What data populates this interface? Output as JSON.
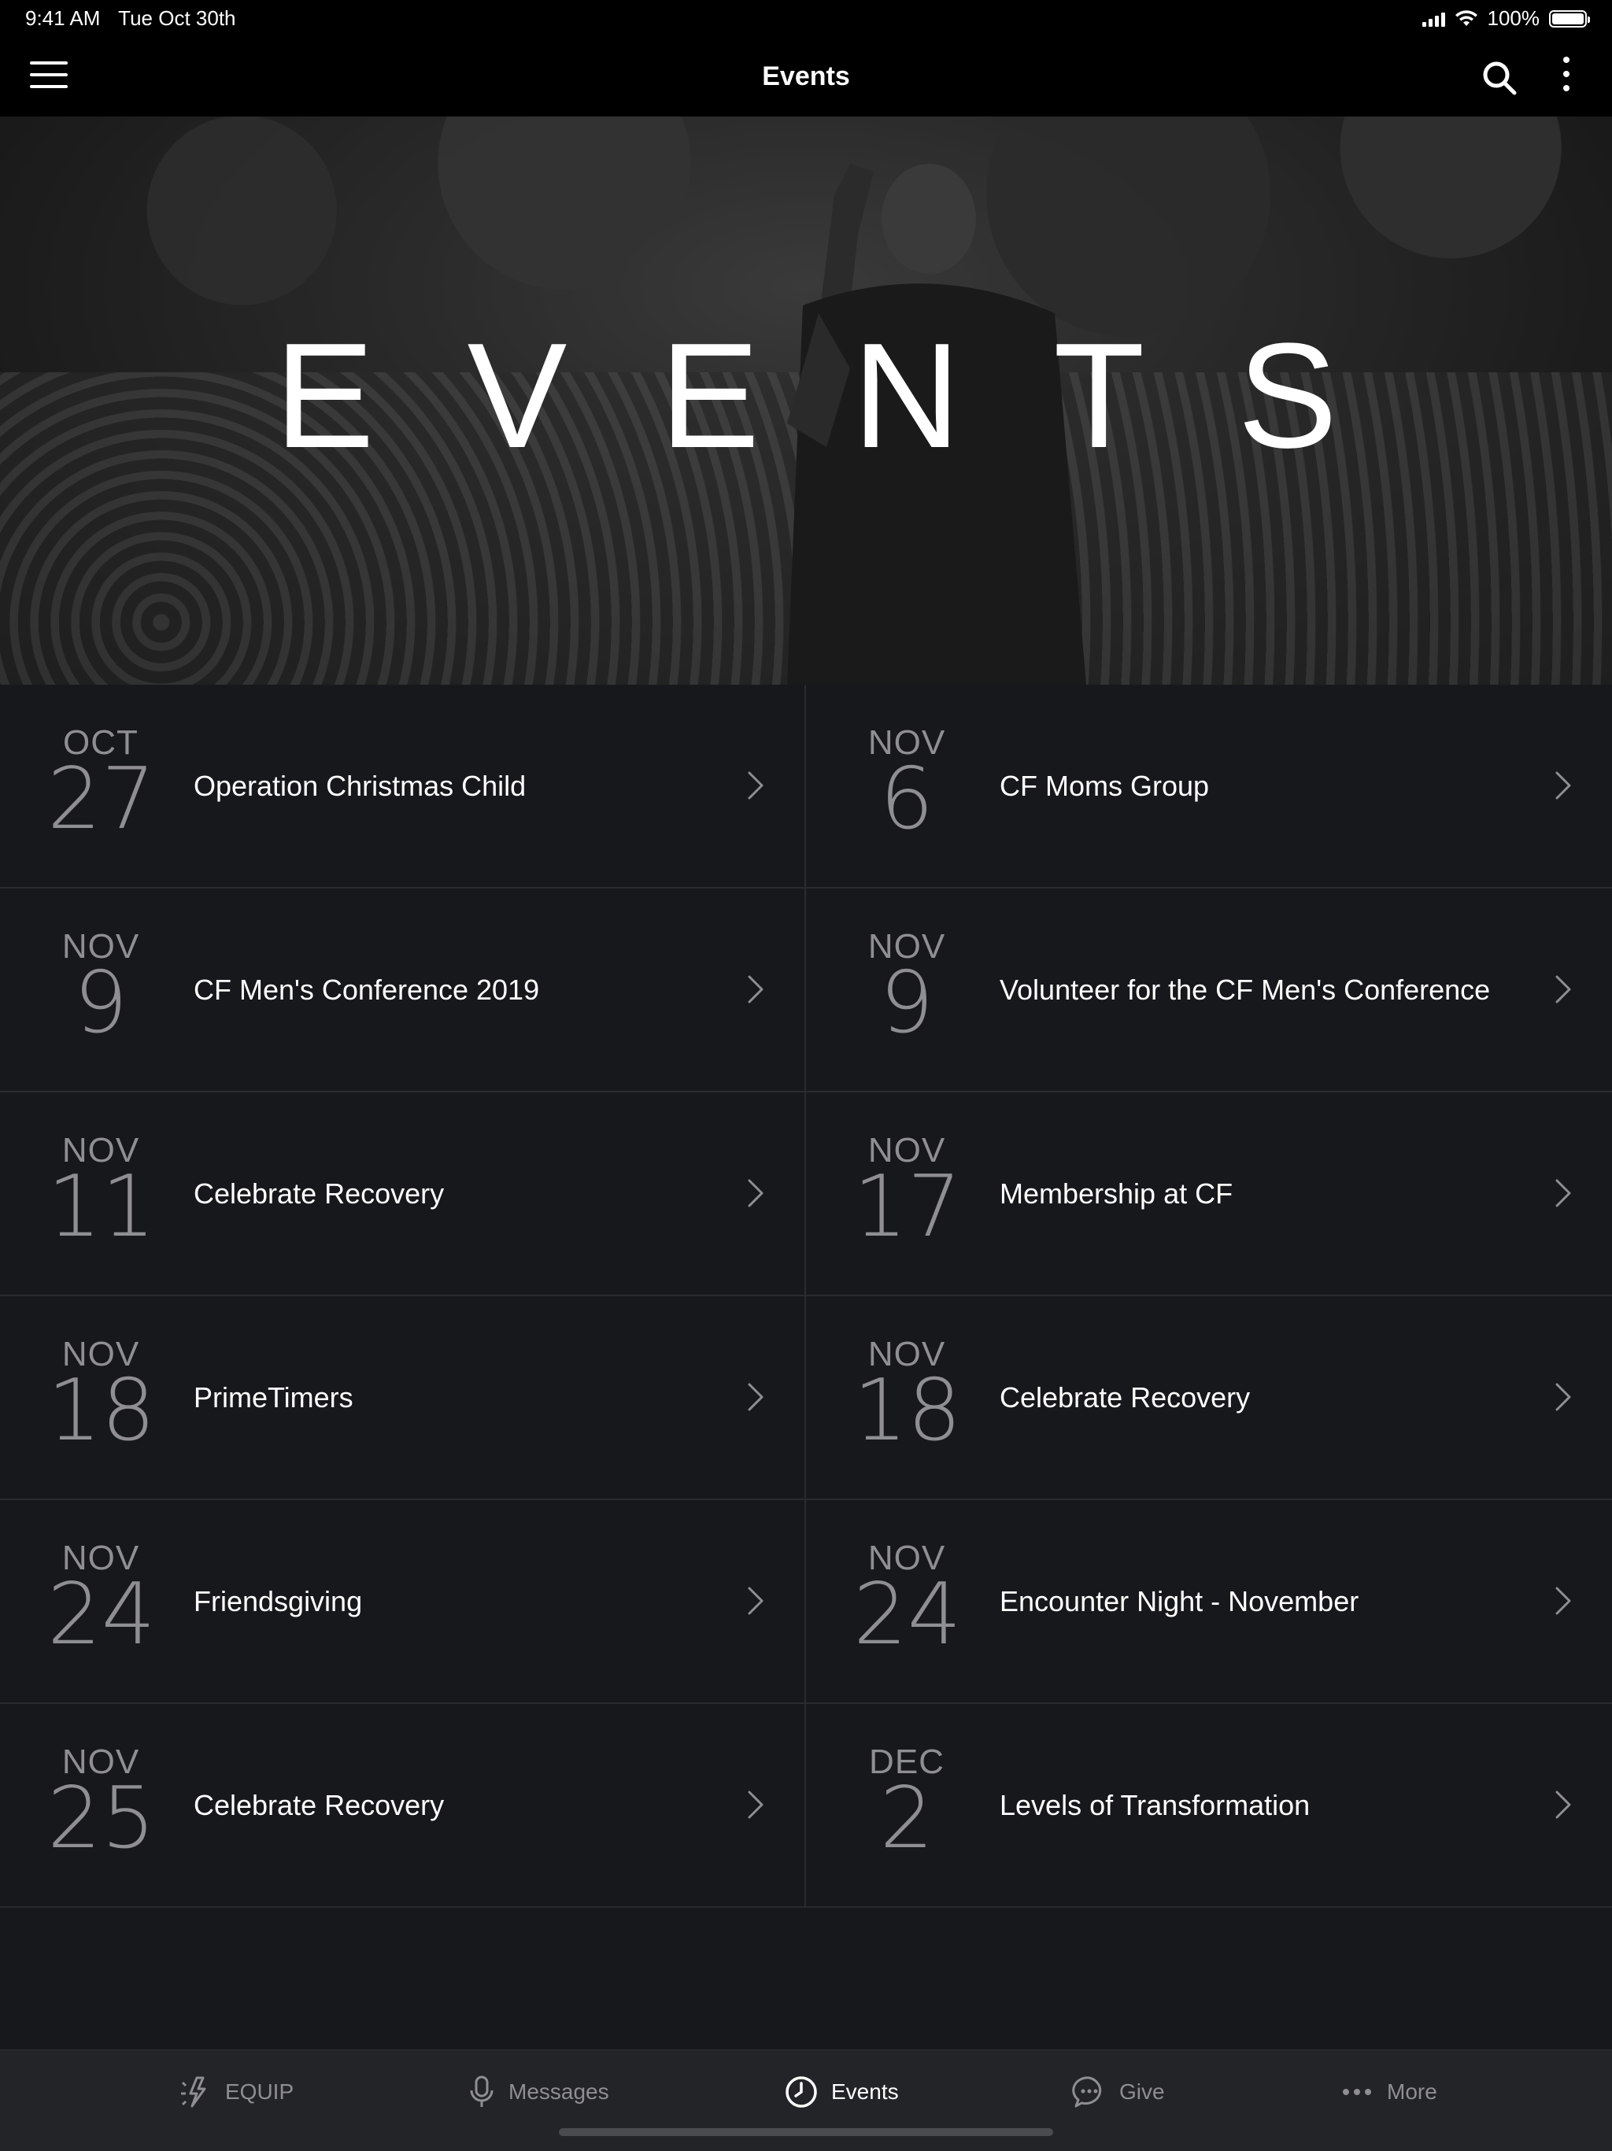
{
  "status_bar": {
    "time": "9:41 AM",
    "date": "Tue Oct 30th",
    "battery": "100%",
    "battery_level": 1.0
  },
  "nav": {
    "title": "Events"
  },
  "hero": {
    "title": "EVENTS"
  },
  "events": [
    {
      "month": "OCT",
      "day": "27",
      "title": "Operation Christmas Child"
    },
    {
      "month": "NOV",
      "day": "6",
      "title": "CF Moms Group"
    },
    {
      "month": "NOV",
      "day": "9",
      "title": "CF Men's Conference 2019"
    },
    {
      "month": "NOV",
      "day": "9",
      "title": "Volunteer for the CF Men's Conference"
    },
    {
      "month": "NOV",
      "day": "11",
      "title": "Celebrate Recovery"
    },
    {
      "month": "NOV",
      "day": "17",
      "title": "Membership at CF"
    },
    {
      "month": "NOV",
      "day": "18",
      "title": "PrimeTimers"
    },
    {
      "month": "NOV",
      "day": "18",
      "title": "Celebrate Recovery"
    },
    {
      "month": "NOV",
      "day": "24",
      "title": "Friendsgiving"
    },
    {
      "month": "NOV",
      "day": "24",
      "title": "Encounter Night - November"
    },
    {
      "month": "NOV",
      "day": "25",
      "title": "Celebrate Recovery"
    },
    {
      "month": "DEC",
      "day": "2",
      "title": "Levels of Transformation"
    }
  ],
  "tabs": [
    {
      "label": "EQUIP",
      "icon": "sparkle-icon",
      "active": false
    },
    {
      "label": "Messages",
      "icon": "microphone-icon",
      "active": false
    },
    {
      "label": "Events",
      "icon": "clock-icon",
      "active": true
    },
    {
      "label": "Give",
      "icon": "chat-bubble-icon",
      "active": false
    },
    {
      "label": "More",
      "icon": "ellipsis-icon",
      "active": false
    }
  ],
  "colors": {
    "background": "#17181b",
    "tab_bar": "#232427",
    "muted_text": "#8e8e93",
    "divider": "#2a2b2e"
  }
}
